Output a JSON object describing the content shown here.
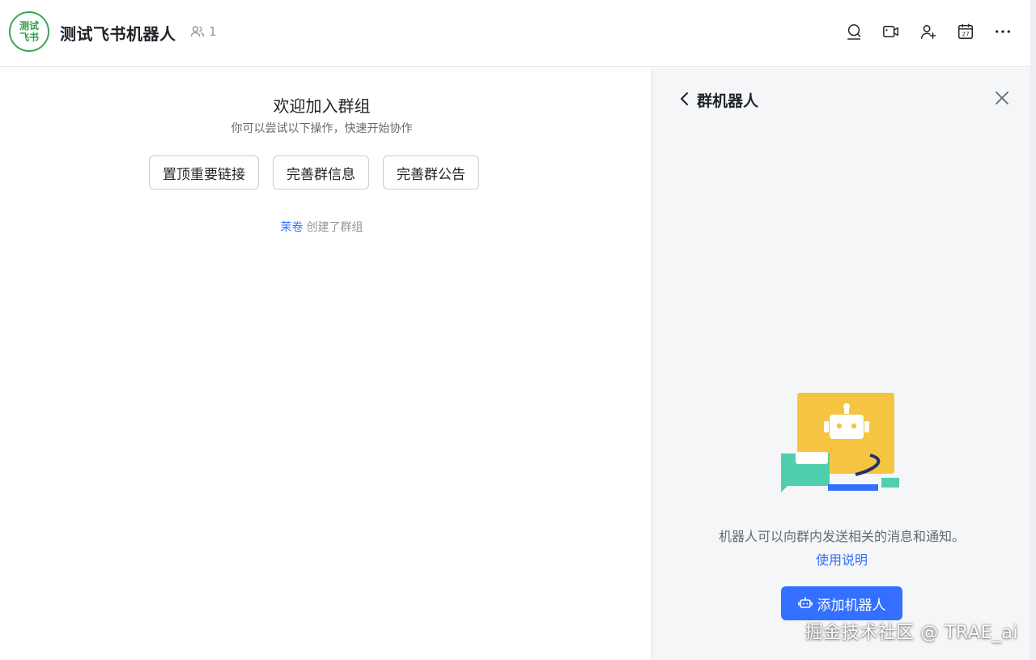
{
  "header": {
    "avatar_line1": "测试",
    "avatar_line2": "飞书",
    "group_name": "测试飞书机器人",
    "member_count": "1",
    "icons": [
      "search-chat-icon",
      "video-call-icon",
      "add-member-icon",
      "calendar-icon",
      "more-icon"
    ],
    "calendar_day": "27"
  },
  "main": {
    "welcome_title": "欢迎加入群组",
    "welcome_subtitle": "你可以尝试以下操作，快速开始协作",
    "quick_actions": [
      "置顶重要链接",
      "完善群信息",
      "完善群公告"
    ],
    "creator": "茉卷",
    "created_text": "创建了群组"
  },
  "panel": {
    "title": "群机器人",
    "description": "机器人可以向群内发送相关的消息和通知。",
    "help_link": "使用说明",
    "add_button": "添加机器人"
  },
  "watermark": "掘金技术社区 @ TRAE_ai",
  "colors": {
    "accent": "#3370ff",
    "avatar_green": "#34a853",
    "illustration_yellow": "#f5c542",
    "illustration_teal": "#4fcfae"
  }
}
